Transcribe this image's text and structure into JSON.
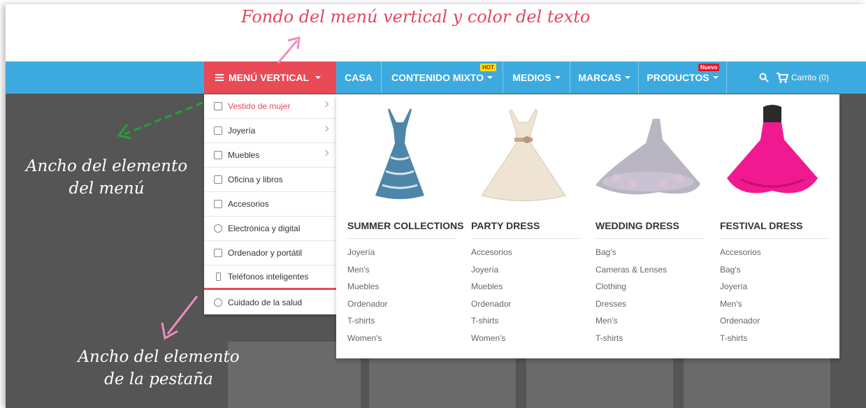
{
  "annotations": {
    "top": "Fondo del menú vertical y color del texto",
    "left_line1": "Ancho del elemento",
    "left_line2": "del menú",
    "bottom_line1": "Ancho del elemento",
    "bottom_line2": "de la pestaña"
  },
  "navbar": {
    "vertical_menu_label": "MENÚ VERTICAL",
    "items": [
      {
        "label": "CASA",
        "badge": ""
      },
      {
        "label": "CONTENIDO MIXTO",
        "badge": "HOT"
      },
      {
        "label": "MEDIOS",
        "badge": ""
      },
      {
        "label": "MARCAS",
        "badge": ""
      },
      {
        "label": "PRODUCTOS",
        "badge": "Nuevo"
      }
    ],
    "cart_label": "Carrito (0)"
  },
  "vertical_menu": {
    "items": [
      {
        "label": "Vestido de mujer",
        "icon": "dress-icon"
      },
      {
        "label": "Joyería",
        "icon": "diamond-icon"
      },
      {
        "label": "Muebles",
        "icon": "sofa-icon"
      },
      {
        "label": "Oficina y libros",
        "icon": "printer-icon"
      },
      {
        "label": "Accesorios",
        "icon": "hanger-icon"
      },
      {
        "label": "Electrónica y digital",
        "icon": "camera-icon"
      },
      {
        "label": "Ordenador y portátil",
        "icon": "laptop-icon"
      },
      {
        "label": "Teléfonos inteligentes",
        "icon": "phone-icon"
      },
      {
        "label": "Cuidado de la salud",
        "icon": "heart-icon"
      }
    ]
  },
  "mega_menu": {
    "columns": [
      {
        "title": "SUMMER COLLECTIONS",
        "links": [
          "Joyería",
          "Men's",
          "Muebles",
          "Ordenador",
          "T-shirts",
          "Women's"
        ]
      },
      {
        "title": "PARTY DRESS",
        "links": [
          "Accesorios",
          "Joyería",
          "Muebles",
          "Ordenador",
          "T-shirts",
          "Women's"
        ]
      },
      {
        "title": "WEDDING DRESS",
        "links": [
          "Bag's",
          "Cameras & Lenses",
          "Clothing",
          "Dresses",
          "Men's",
          "T-shirts"
        ]
      },
      {
        "title": "FESTIVAL DRESS",
        "links": [
          "Accesorios",
          "Bag's",
          "Joyería",
          "Men's",
          "Ordenador",
          "T-shirts"
        ]
      }
    ]
  },
  "colors": {
    "navbar": "#3daadf",
    "vertical_menu_bg": "#e84b55",
    "annotation_pink": "#e24762",
    "arrow_green": "#23a23a",
    "arrow_pink": "#f08cc0"
  }
}
